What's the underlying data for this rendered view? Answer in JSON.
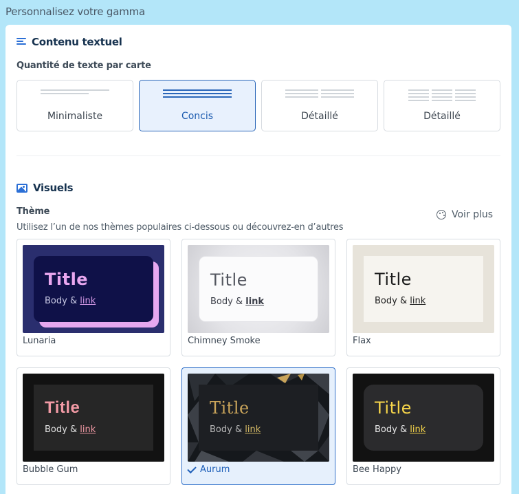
{
  "header": {
    "title": "Personnalisez votre gamma"
  },
  "text_section": {
    "title": "Contenu textuel",
    "amount_label": "Quantité de texte par carte",
    "options": [
      {
        "label": "Minimaliste",
        "selected": false
      },
      {
        "label": "Concis",
        "selected": true
      },
      {
        "label": "Détaillé",
        "selected": false
      },
      {
        "label": "Détaillé",
        "selected": false
      }
    ]
  },
  "visuals_section": {
    "title": "Visuels",
    "theme_label": "Thème",
    "theme_help": "Utilisez l’un de nos thèmes populaires ci-dessous ou découvrez-en d’autres",
    "see_more": "Voir plus",
    "themes": [
      {
        "name": "Lunaria",
        "preview_title": "Title",
        "preview_body": "Body & ",
        "preview_link": "link",
        "selected": false
      },
      {
        "name": "Chimney Smoke",
        "preview_title": "Title",
        "preview_body": "Body & ",
        "preview_link": "link",
        "selected": false
      },
      {
        "name": "Flax",
        "preview_title": "Title",
        "preview_body": "Body & ",
        "preview_link": "link",
        "selected": false
      },
      {
        "name": "Bubble Gum",
        "preview_title": "Title",
        "preview_body": "Body & ",
        "preview_link": "link",
        "selected": false
      },
      {
        "name": "Aurum",
        "preview_title": "Title",
        "preview_body": "Body & ",
        "preview_link": "link",
        "selected": true
      },
      {
        "name": "Bee Happy",
        "preview_title": "Title",
        "preview_body": "Body & ",
        "preview_link": "link",
        "selected": false
      }
    ]
  },
  "colors": {
    "accent": "#2a66b8",
    "selected_bg": "#e8f1fd",
    "page_bg": "#b3e6f9"
  }
}
